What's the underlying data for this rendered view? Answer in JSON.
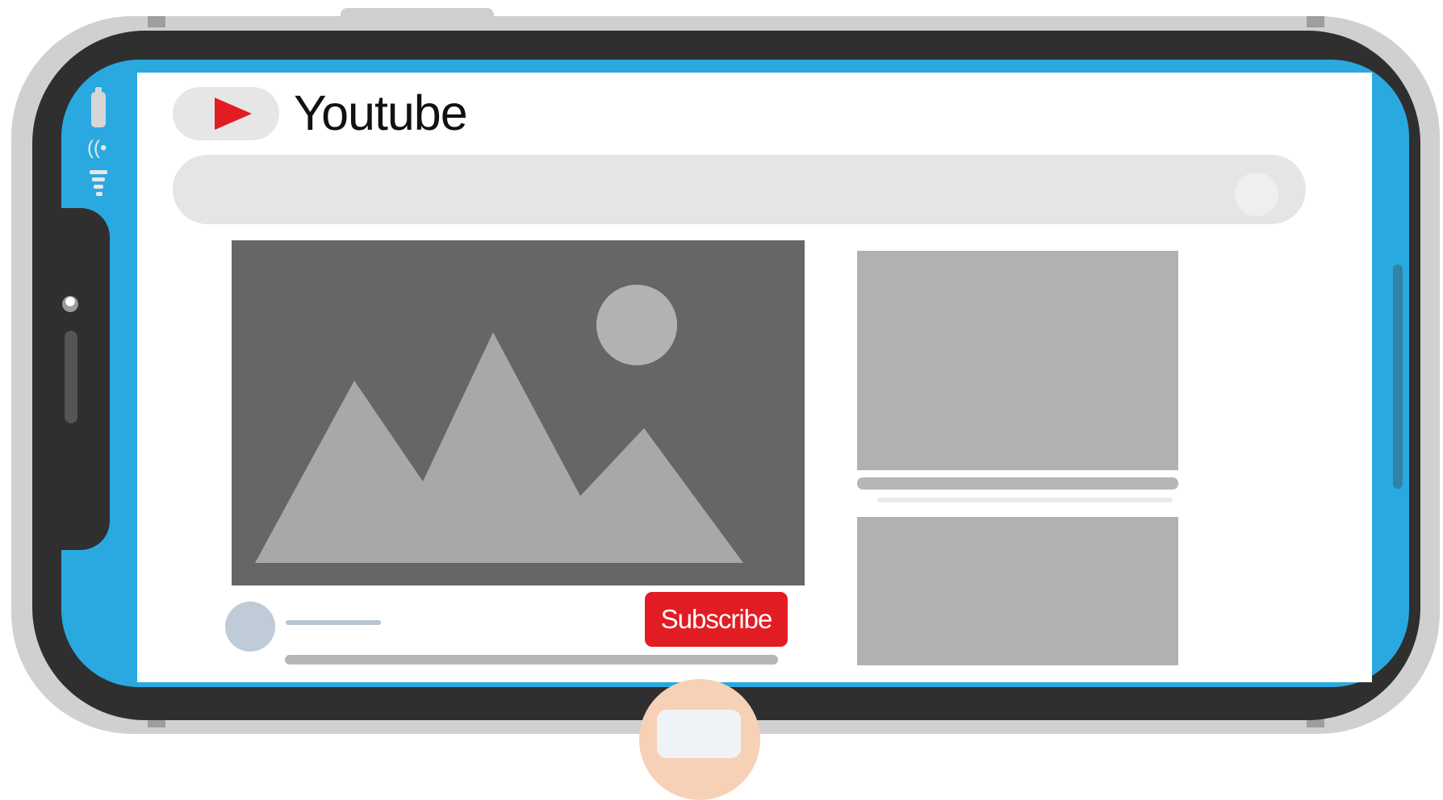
{
  "app": {
    "title": "Youtube",
    "brand_color": "#e21c23",
    "screen_border_color": "#2aa9e0"
  },
  "status_bar": {
    "icons": [
      "battery-icon",
      "wifi-icon",
      "signal-icon"
    ]
  },
  "header": {
    "logo_icon": "play-icon"
  },
  "search": {
    "icon": "search-icon"
  },
  "channel": {
    "subscribe_label": "Subscribe"
  },
  "sidebar": {
    "items": [
      {
        "type": "video-thumbnail"
      },
      {
        "type": "video-thumbnail"
      }
    ]
  }
}
